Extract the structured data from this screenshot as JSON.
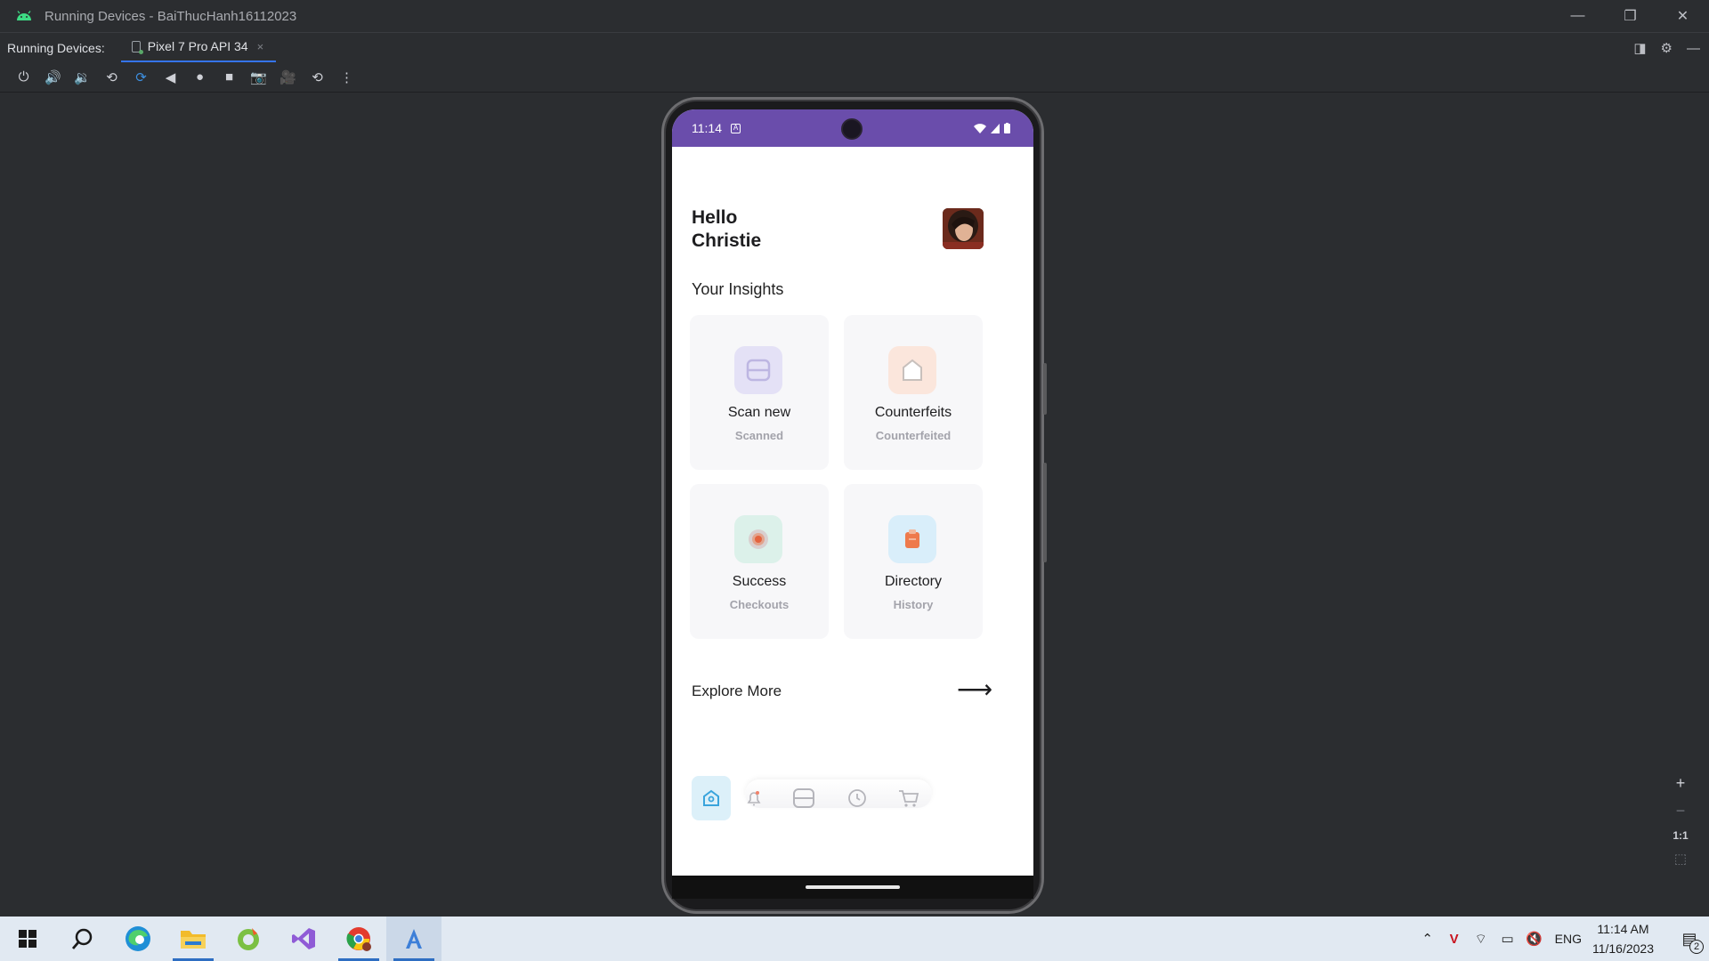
{
  "window": {
    "title": "Running Devices - BaiThucHanh16112023",
    "controls": {
      "minimize": "—",
      "restore": "❐",
      "close": "✕"
    }
  },
  "tabbar": {
    "label": "Running Devices:",
    "device_tab": "Pixel 7 Pro API 34",
    "close_glyph": "×"
  },
  "toolbar": {
    "icons": [
      "power-icon",
      "volume-up-icon",
      "volume-down-icon",
      "rotate-left-icon",
      "rotate-right-icon",
      "back-icon",
      "home-icon",
      "overview-icon",
      "screenshot-icon",
      "screen-record-icon",
      "snapshot-icon",
      "more-icon"
    ]
  },
  "phone": {
    "status": {
      "time": "11:14",
      "a_glyph": "A"
    },
    "greeting": {
      "line1": "Hello",
      "line2": "Christie"
    },
    "insights_title": "Your Insights",
    "cards": [
      {
        "title": "Scan new",
        "subtitle": "Scanned",
        "icon": "scan-icon",
        "color": "#e4e1f6"
      },
      {
        "title": "Counterfeits",
        "subtitle": "Counterfeited",
        "icon": "house-icon",
        "color": "#fbe6dc"
      },
      {
        "title": "Success",
        "subtitle": "Checkouts",
        "icon": "target-icon",
        "color": "#dcf1ea"
      },
      {
        "title": "Directory",
        "subtitle": "History",
        "icon": "clipboard-icon",
        "color": "#d9eefa"
      }
    ],
    "explore": "Explore More",
    "explore_arrow": "⟶",
    "bottom_nav": [
      "home-icon",
      "bell-icon",
      "scan-icon",
      "history-icon",
      "cart-icon"
    ]
  },
  "zoom": {
    "plus": "+",
    "minus": "−",
    "one_to_one": "1:1"
  },
  "taskbar": {
    "lang": "ENG",
    "time": "11:14 AM",
    "date": "11/16/2023",
    "notif_count": "2"
  }
}
